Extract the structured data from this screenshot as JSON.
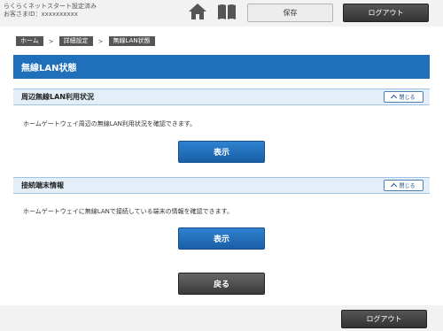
{
  "header": {
    "status_line1": "らくらくネットスタート設定済み",
    "status_line2": "お客さまID：xxxxxxxxxx",
    "home_icon": "home-icon",
    "manual_icon": "book-icon",
    "save_label": "保存",
    "logout_label": "ログアウト"
  },
  "breadcrumb": [
    "ホーム",
    "詳細設定",
    "無線LAN状態"
  ],
  "page_title": "無線LAN状態",
  "sections": [
    {
      "title": "周辺無線LAN利用状況",
      "close_label": "閉じる",
      "description": "ホームゲートウェイ周辺の無線LAN利用状況を確認できます。",
      "button_label": "表示"
    },
    {
      "title": "接続端末情報",
      "close_label": "閉じる",
      "description": "ホームゲートウェイに無線LANで接続している端末の情報を確認できます。",
      "button_label": "表示"
    }
  ],
  "back_label": "戻る",
  "footer": {
    "logout_label": "ログアウト"
  },
  "colors": {
    "accent": "#1f6fba",
    "section_bg": "#e3eef8",
    "dark_button": "#3a3a3a"
  }
}
